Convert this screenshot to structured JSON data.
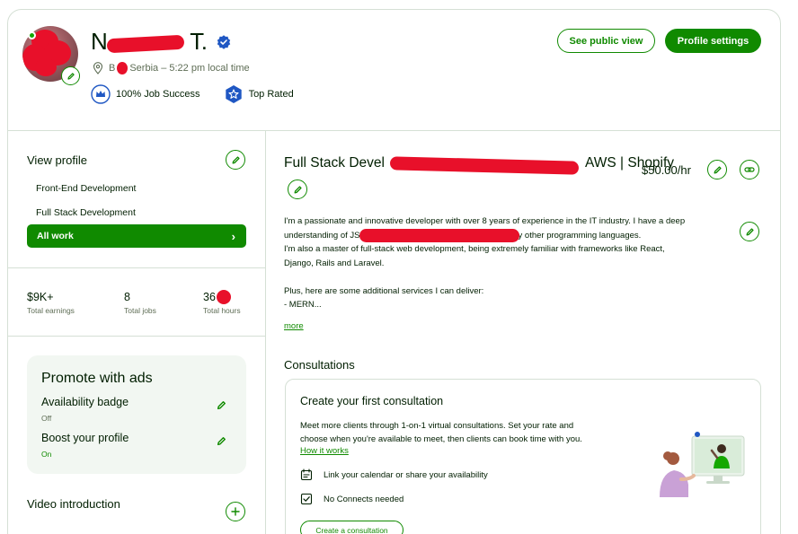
{
  "header": {
    "name_first": "N",
    "name_last": "T.",
    "location_prefix": "B",
    "location_suffix": "Serbia – 5:22 pm local time",
    "job_success": "100% Job Success",
    "top_rated": "Top Rated",
    "see_public_view": "See public view",
    "profile_settings": "Profile settings"
  },
  "sidebar": {
    "view_profile": "View profile",
    "specializations": [
      "Front-End Development",
      "Full Stack Development"
    ],
    "all_work": "All work",
    "all_work_chevron": "›",
    "stats": [
      {
        "value": "$9K+",
        "label": "Total earnings"
      },
      {
        "value": "8",
        "label": "Total jobs"
      },
      {
        "value": "36",
        "label": "Total hours"
      }
    ],
    "promote": {
      "title": "Promote with ads",
      "availability_label": "Availability badge",
      "availability_status": "Off",
      "boost_label": "Boost your profile",
      "boost_status": "On"
    },
    "video_intro": "Video introduction"
  },
  "main": {
    "title_start": "Full Stack Devel",
    "title_end": "AWS | Shopify",
    "rate": "$50.00/hr",
    "description_line1": "I'm a passionate and innovative developer with over 8 years of experience in the IT industry. I have a deep",
    "description_line2_start": "understanding of JS",
    "description_line2_end": "y other programming languages.",
    "description_line3": "I'm also a master of full-stack web development, being extremely familiar with frameworks like React,",
    "description_line4": "Django, Rails and Laravel.",
    "description_line5": "Plus, here are some additional services I can deliver:",
    "description_line6": "- MERN...",
    "more": "more",
    "consultations_title": "Consultations",
    "consultation": {
      "title": "Create your first consultation",
      "desc_line1": "Meet more clients through 1-on-1 virtual consultations. Set your rate and",
      "desc_line2": "choose when you're available to meet, then clients can book time with you.",
      "how_it_works": "How it works",
      "feature1": "Link your calendar or share your availability",
      "feature2": "No Connects needed",
      "button": "Create a consultation"
    }
  },
  "colors": {
    "brand_green": "#108a00",
    "text_dark": "#001e00",
    "text_muted": "#5e6d55",
    "border": "#d5e0d5",
    "badge_blue": "#1f57c3",
    "redaction": "#e8102a"
  },
  "icons": [
    "pencil-icon",
    "verified-icon",
    "location-pin-icon",
    "crown-icon",
    "star-badge-icon",
    "link-icon",
    "chevron-right-icon",
    "plus-icon",
    "calendar-icon",
    "checkbox-icon"
  ]
}
